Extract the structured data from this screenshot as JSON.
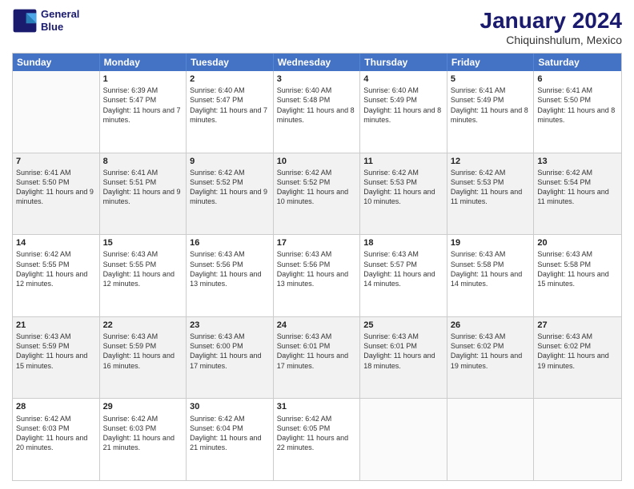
{
  "header": {
    "logo_line1": "General",
    "logo_line2": "Blue",
    "title": "January 2024",
    "subtitle": "Chiquinshulum, Mexico"
  },
  "days": [
    "Sunday",
    "Monday",
    "Tuesday",
    "Wednesday",
    "Thursday",
    "Friday",
    "Saturday"
  ],
  "weeks": [
    [
      {
        "num": "",
        "sunrise": "",
        "sunset": "",
        "daylight": ""
      },
      {
        "num": "1",
        "sunrise": "Sunrise: 6:39 AM",
        "sunset": "Sunset: 5:47 PM",
        "daylight": "Daylight: 11 hours and 7 minutes."
      },
      {
        "num": "2",
        "sunrise": "Sunrise: 6:40 AM",
        "sunset": "Sunset: 5:47 PM",
        "daylight": "Daylight: 11 hours and 7 minutes."
      },
      {
        "num": "3",
        "sunrise": "Sunrise: 6:40 AM",
        "sunset": "Sunset: 5:48 PM",
        "daylight": "Daylight: 11 hours and 8 minutes."
      },
      {
        "num": "4",
        "sunrise": "Sunrise: 6:40 AM",
        "sunset": "Sunset: 5:49 PM",
        "daylight": "Daylight: 11 hours and 8 minutes."
      },
      {
        "num": "5",
        "sunrise": "Sunrise: 6:41 AM",
        "sunset": "Sunset: 5:49 PM",
        "daylight": "Daylight: 11 hours and 8 minutes."
      },
      {
        "num": "6",
        "sunrise": "Sunrise: 6:41 AM",
        "sunset": "Sunset: 5:50 PM",
        "daylight": "Daylight: 11 hours and 8 minutes."
      }
    ],
    [
      {
        "num": "7",
        "sunrise": "Sunrise: 6:41 AM",
        "sunset": "Sunset: 5:50 PM",
        "daylight": "Daylight: 11 hours and 9 minutes."
      },
      {
        "num": "8",
        "sunrise": "Sunrise: 6:41 AM",
        "sunset": "Sunset: 5:51 PM",
        "daylight": "Daylight: 11 hours and 9 minutes."
      },
      {
        "num": "9",
        "sunrise": "Sunrise: 6:42 AM",
        "sunset": "Sunset: 5:52 PM",
        "daylight": "Daylight: 11 hours and 9 minutes."
      },
      {
        "num": "10",
        "sunrise": "Sunrise: 6:42 AM",
        "sunset": "Sunset: 5:52 PM",
        "daylight": "Daylight: 11 hours and 10 minutes."
      },
      {
        "num": "11",
        "sunrise": "Sunrise: 6:42 AM",
        "sunset": "Sunset: 5:53 PM",
        "daylight": "Daylight: 11 hours and 10 minutes."
      },
      {
        "num": "12",
        "sunrise": "Sunrise: 6:42 AM",
        "sunset": "Sunset: 5:53 PM",
        "daylight": "Daylight: 11 hours and 11 minutes."
      },
      {
        "num": "13",
        "sunrise": "Sunrise: 6:42 AM",
        "sunset": "Sunset: 5:54 PM",
        "daylight": "Daylight: 11 hours and 11 minutes."
      }
    ],
    [
      {
        "num": "14",
        "sunrise": "Sunrise: 6:42 AM",
        "sunset": "Sunset: 5:55 PM",
        "daylight": "Daylight: 11 hours and 12 minutes."
      },
      {
        "num": "15",
        "sunrise": "Sunrise: 6:43 AM",
        "sunset": "Sunset: 5:55 PM",
        "daylight": "Daylight: 11 hours and 12 minutes."
      },
      {
        "num": "16",
        "sunrise": "Sunrise: 6:43 AM",
        "sunset": "Sunset: 5:56 PM",
        "daylight": "Daylight: 11 hours and 13 minutes."
      },
      {
        "num": "17",
        "sunrise": "Sunrise: 6:43 AM",
        "sunset": "Sunset: 5:56 PM",
        "daylight": "Daylight: 11 hours and 13 minutes."
      },
      {
        "num": "18",
        "sunrise": "Sunrise: 6:43 AM",
        "sunset": "Sunset: 5:57 PM",
        "daylight": "Daylight: 11 hours and 14 minutes."
      },
      {
        "num": "19",
        "sunrise": "Sunrise: 6:43 AM",
        "sunset": "Sunset: 5:58 PM",
        "daylight": "Daylight: 11 hours and 14 minutes."
      },
      {
        "num": "20",
        "sunrise": "Sunrise: 6:43 AM",
        "sunset": "Sunset: 5:58 PM",
        "daylight": "Daylight: 11 hours and 15 minutes."
      }
    ],
    [
      {
        "num": "21",
        "sunrise": "Sunrise: 6:43 AM",
        "sunset": "Sunset: 5:59 PM",
        "daylight": "Daylight: 11 hours and 15 minutes."
      },
      {
        "num": "22",
        "sunrise": "Sunrise: 6:43 AM",
        "sunset": "Sunset: 5:59 PM",
        "daylight": "Daylight: 11 hours and 16 minutes."
      },
      {
        "num": "23",
        "sunrise": "Sunrise: 6:43 AM",
        "sunset": "Sunset: 6:00 PM",
        "daylight": "Daylight: 11 hours and 17 minutes."
      },
      {
        "num": "24",
        "sunrise": "Sunrise: 6:43 AM",
        "sunset": "Sunset: 6:01 PM",
        "daylight": "Daylight: 11 hours and 17 minutes."
      },
      {
        "num": "25",
        "sunrise": "Sunrise: 6:43 AM",
        "sunset": "Sunset: 6:01 PM",
        "daylight": "Daylight: 11 hours and 18 minutes."
      },
      {
        "num": "26",
        "sunrise": "Sunrise: 6:43 AM",
        "sunset": "Sunset: 6:02 PM",
        "daylight": "Daylight: 11 hours and 19 minutes."
      },
      {
        "num": "27",
        "sunrise": "Sunrise: 6:43 AM",
        "sunset": "Sunset: 6:02 PM",
        "daylight": "Daylight: 11 hours and 19 minutes."
      }
    ],
    [
      {
        "num": "28",
        "sunrise": "Sunrise: 6:42 AM",
        "sunset": "Sunset: 6:03 PM",
        "daylight": "Daylight: 11 hours and 20 minutes."
      },
      {
        "num": "29",
        "sunrise": "Sunrise: 6:42 AM",
        "sunset": "Sunset: 6:03 PM",
        "daylight": "Daylight: 11 hours and 21 minutes."
      },
      {
        "num": "30",
        "sunrise": "Sunrise: 6:42 AM",
        "sunset": "Sunset: 6:04 PM",
        "daylight": "Daylight: 11 hours and 21 minutes."
      },
      {
        "num": "31",
        "sunrise": "Sunrise: 6:42 AM",
        "sunset": "Sunset: 6:05 PM",
        "daylight": "Daylight: 11 hours and 22 minutes."
      },
      {
        "num": "",
        "sunrise": "",
        "sunset": "",
        "daylight": ""
      },
      {
        "num": "",
        "sunrise": "",
        "sunset": "",
        "daylight": ""
      },
      {
        "num": "",
        "sunrise": "",
        "sunset": "",
        "daylight": ""
      }
    ]
  ]
}
